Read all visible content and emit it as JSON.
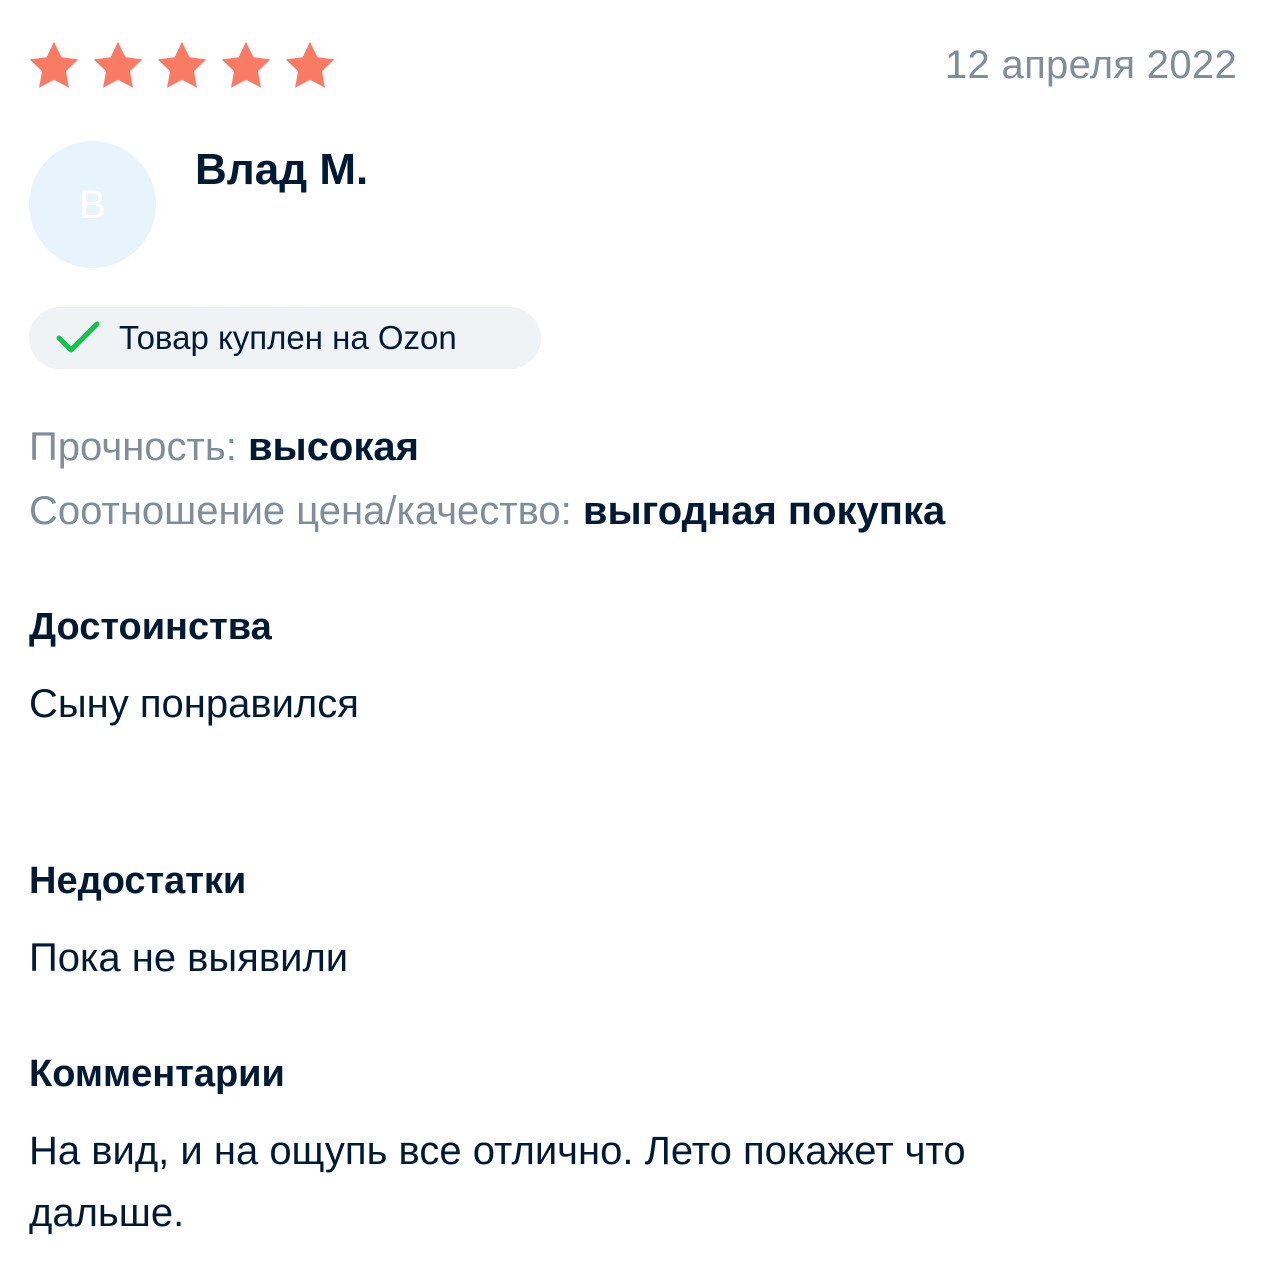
{
  "review": {
    "rating": 5,
    "rating_max": 5,
    "star_color": "#f97b63",
    "date": "12 апреля 2022",
    "author": {
      "avatar_letter": "В",
      "name": "Влад М."
    },
    "verified_badge": {
      "label": "Товар куплен на Ozon",
      "icon": "checkmark-icon",
      "icon_color": "#10c44c"
    },
    "attributes": [
      {
        "label": "Прочность:",
        "value": "высокая"
      },
      {
        "label": "Соотношение цена/качество:",
        "value": "выгодная покупка"
      }
    ],
    "pros": {
      "title": "Достоинства",
      "text": "Сыну понравился"
    },
    "cons": {
      "title": "Недостатки",
      "text": "Пока не выявили"
    },
    "comment": {
      "title": "Комментарии",
      "text": "На вид, и на ощупь все отлично. Лето покажет что дальше."
    }
  }
}
